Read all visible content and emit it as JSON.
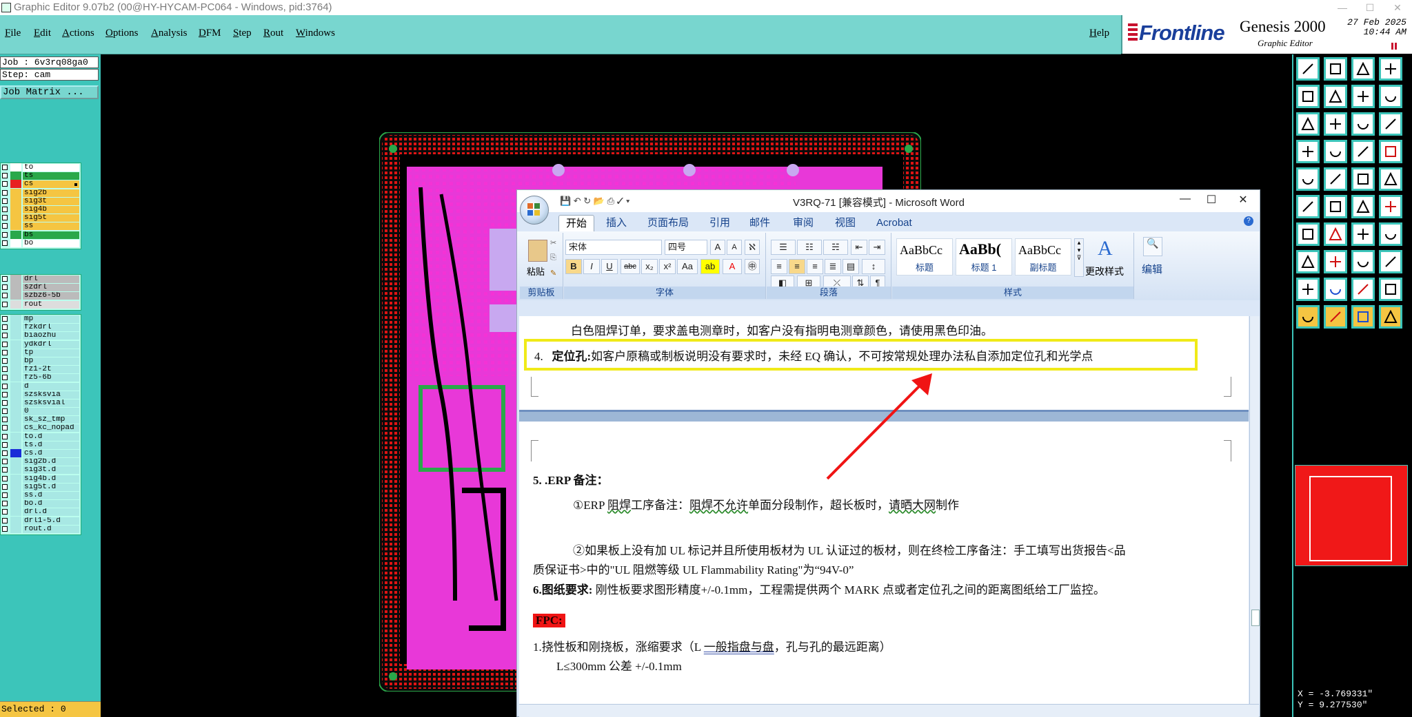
{
  "window": {
    "title": "Graphic Editor 9.07b2 (00@HY-HYCAM-PC064 - Windows, pid:3764)"
  },
  "menu": {
    "items": [
      "File",
      "Edit",
      "Actions",
      "Options",
      "Analysis",
      "DFM",
      "Step",
      "Rout",
      "Windows"
    ],
    "help": "Help"
  },
  "brand": {
    "logo": "Frontline",
    "product": "Genesis 2000",
    "subtitle": "Graphic Editor",
    "date": "27 Feb 2025",
    "time": "10:44 AM"
  },
  "job": {
    "job_label": "Job : 6v3rq08ga0",
    "step_label": "Step: cam",
    "matrix_button": "Job Matrix ..."
  },
  "layers": {
    "groups": [
      [
        {
          "name": "to",
          "color": "#ffffff",
          "bg": "#ffffff",
          "active": false
        },
        {
          "name": "ts",
          "color": "#2aa84a",
          "bg": "#2aa84a",
          "active": false
        },
        {
          "name": "cs",
          "color": "#e82020",
          "bg": "#f5c542",
          "active": true
        },
        {
          "name": "sig2b",
          "color": "#f5c542",
          "bg": "#f5c542",
          "active": false
        },
        {
          "name": "sig3t",
          "color": "#f5c542",
          "bg": "#f5c542",
          "active": false
        },
        {
          "name": "sig4b",
          "color": "#f5c542",
          "bg": "#f5c542",
          "active": false
        },
        {
          "name": "sig5t",
          "color": "#f5c542",
          "bg": "#f5c542",
          "active": false
        },
        {
          "name": "ss",
          "color": "#f5c542",
          "bg": "#f5c542",
          "active": false
        },
        {
          "name": "bs",
          "color": "#2aa84a",
          "bg": "#2aa84a",
          "active": false
        },
        {
          "name": "bo",
          "color": "#ffffff",
          "bg": "#ffffff",
          "active": false
        }
      ],
      [
        {
          "name": "drl",
          "color": "#bbbbbb",
          "bg": "#bbbbbb",
          "active": false
        },
        {
          "name": "szdrl",
          "color": "#bbbbbb",
          "bg": "#bbbbbb",
          "active": false
        },
        {
          "name": "szbz6-5b",
          "color": "#bbbbbb",
          "bg": "#bbbbbb",
          "active": false
        },
        {
          "name": "rout",
          "color": "#dddddd",
          "bg": "#dddddd",
          "active": false
        }
      ],
      [
        {
          "name": "mp",
          "color": "#a8e8e4",
          "bg": "#a8e8e4",
          "active": false
        },
        {
          "name": "fzkdrl",
          "color": "#a8e8e4",
          "bg": "#a8e8e4",
          "active": false
        },
        {
          "name": "biaozhu",
          "color": "#a8e8e4",
          "bg": "#a8e8e4",
          "active": false
        },
        {
          "name": "ydkdrl",
          "color": "#a8e8e4",
          "bg": "#a8e8e4",
          "active": false
        },
        {
          "name": "tp",
          "color": "#a8e8e4",
          "bg": "#a8e8e4",
          "active": false
        },
        {
          "name": "bp",
          "color": "#a8e8e4",
          "bg": "#a8e8e4",
          "active": false
        },
        {
          "name": "fz1-2t",
          "color": "#a8e8e4",
          "bg": "#a8e8e4",
          "active": false
        },
        {
          "name": "fz5-6b",
          "color": "#a8e8e4",
          "bg": "#a8e8e4",
          "active": false
        },
        {
          "name": "d",
          "color": "#a8e8e4",
          "bg": "#a8e8e4",
          "active": false
        },
        {
          "name": "szsksvia",
          "color": "#a8e8e4",
          "bg": "#a8e8e4",
          "active": false
        },
        {
          "name": "szsksvial",
          "color": "#a8e8e4",
          "bg": "#a8e8e4",
          "active": false
        },
        {
          "name": "0",
          "color": "#a8e8e4",
          "bg": "#a8e8e4",
          "active": false
        },
        {
          "name": "sk_sz_tmp",
          "color": "#a8e8e4",
          "bg": "#a8e8e4",
          "active": false
        },
        {
          "name": "cs_kc_nopad",
          "color": "#a8e8e4",
          "bg": "#a8e8e4",
          "active": false
        },
        {
          "name": "to.d",
          "color": "#a8e8e4",
          "bg": "#a8e8e4",
          "active": false
        },
        {
          "name": "ts.d",
          "color": "#a8e8e4",
          "bg": "#a8e8e4",
          "active": false
        },
        {
          "name": "cs.d",
          "color": "#1a2cd8",
          "bg": "#a8e8e4",
          "active": false
        },
        {
          "name": "sig2b.d",
          "color": "#a8e8e4",
          "bg": "#a8e8e4",
          "active": false
        },
        {
          "name": "sig3t.d",
          "color": "#a8e8e4",
          "bg": "#a8e8e4",
          "active": false
        },
        {
          "name": "sig4b.d",
          "color": "#a8e8e4",
          "bg": "#a8e8e4",
          "active": false
        },
        {
          "name": "sig5t.d",
          "color": "#a8e8e4",
          "bg": "#a8e8e4",
          "active": false
        },
        {
          "name": "ss.d",
          "color": "#a8e8e4",
          "bg": "#a8e8e4",
          "active": false
        },
        {
          "name": "bo.d",
          "color": "#a8e8e4",
          "bg": "#a8e8e4",
          "active": false
        },
        {
          "name": "drl.d",
          "color": "#a8e8e4",
          "bg": "#a8e8e4",
          "active": false
        },
        {
          "name": "drl1-5.d",
          "color": "#a8e8e4",
          "bg": "#a8e8e4",
          "active": false
        },
        {
          "name": "rout.d",
          "color": "#a8e8e4",
          "bg": "#a8e8e4",
          "active": false
        }
      ]
    ]
  },
  "status": {
    "selected": "Selected : 0",
    "x": "X = -3.769331\"",
    "y": "Y =  9.277530\""
  },
  "word": {
    "title": "V3RQ-71 [兼容模式] - Microsoft Word",
    "tabs": [
      "开始",
      "插入",
      "页面布局",
      "引用",
      "邮件",
      "审阅",
      "视图",
      "Acrobat"
    ],
    "clipboard": {
      "paste": "粘贴",
      "label": "剪贴板"
    },
    "font": {
      "name": "宋体",
      "size": "四号",
      "label": "字体"
    },
    "paragraph": {
      "label": "段落"
    },
    "styles": {
      "items": [
        {
          "preview": "AaBbCc",
          "name": "标题"
        },
        {
          "preview": "AaBb(",
          "name": "标题 1"
        },
        {
          "preview": "AaBbCc",
          "name": "副标题"
        }
      ],
      "change": "更改样式",
      "label": "样式"
    },
    "editing": {
      "label": "编辑"
    },
    "doc": {
      "line1": "白色阻焊订单，要求盖电测章时，如客户没有指明电测章颜色，请使用黑色印油。",
      "item4_num": "4.",
      "item4_bold": "定位孔:",
      "item4_text": "如客户原稿或制板说明没有要求时，未经 EQ 确认，不可按常规处理办法私自添加定位孔和光学点",
      "erp_title": "5. .ERP 备注：",
      "erp1_a": "①ERP ",
      "erp1_b": "阻焊",
      "erp1_c": "工序备注：",
      "erp1_d": "阻焊不允许",
      "erp1_e": "单面分段制作，超长板时，",
      "erp1_f": "请晒大网",
      "erp1_g": "制作",
      "erp2_a": "②如果板上没有加 UL 标记并且所使用板材为 UL 认证过的板材，则在终检工序备注：手工填写出货报告<品",
      "erp2_b": "质保证书>中的\"UL 阻燃等级 UL Flammability Rating\"为“94V-0”",
      "item6_bold": "6.图纸要求:",
      "item6_text": "刚性板要求图形精度+/-0.1mm，工程需提供两个 MARK 点或者定位孔之间的距离图纸给工厂监控。",
      "fpc": "FPC:",
      "fpc1_a": "1.挠性板和刚挠板，涨缩要求（L ",
      "fpc1_b": "一般指盘与盘",
      "fpc1_c": "，孔与孔的最远距离）",
      "fpc2": "L≤300mm 公差 +/-0.1mm"
    }
  }
}
